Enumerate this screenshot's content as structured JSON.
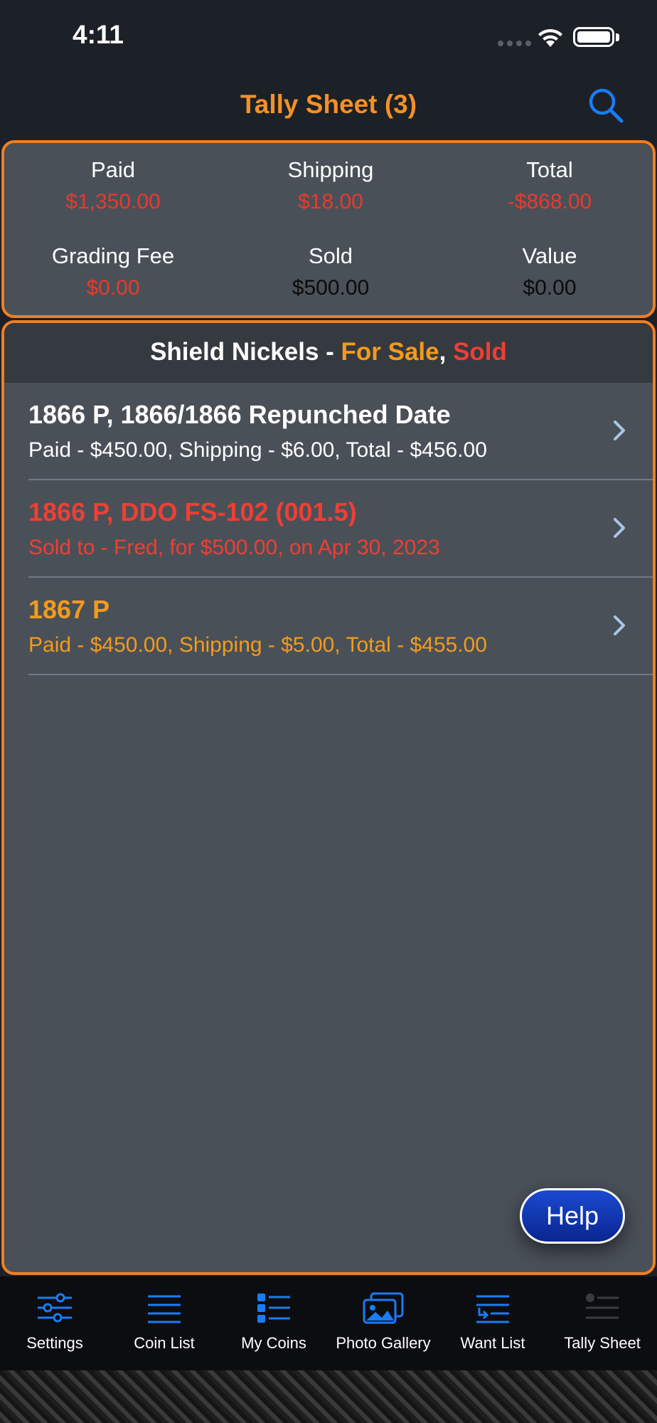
{
  "status_bar": {
    "time": "4:11"
  },
  "nav": {
    "title": "Tally Sheet (3)"
  },
  "summary": {
    "paid_label": "Paid",
    "paid_value": "$1,350.00",
    "shipping_label": "Shipping",
    "shipping_value": "$18.00",
    "total_label": "Total",
    "total_value": "-$868.00",
    "grading_label": "Grading Fee",
    "grading_value": "$0.00",
    "sold_label": "Sold",
    "sold_value": "$500.00",
    "value_label": "Value",
    "value_value": "$0.00"
  },
  "section": {
    "title": "Shield Nickels - ",
    "for_sale": "For Sale",
    "comma": ", ",
    "sold": "Sold"
  },
  "items": [
    {
      "title": "1866 P, 1866/1866 Repunched Date",
      "subtitle": "Paid - $450.00, Shipping - $6.00, Total - $456.00",
      "color": "#ffffff"
    },
    {
      "title": "1866 P, DDO FS-102 (001.5)",
      "subtitle": "Sold to - Fred, for $500.00, on Apr 30, 2023",
      "color": "#ee3f34"
    },
    {
      "title": "1867 P",
      "subtitle": "Paid - $450.00, Shipping - $5.00, Total - $455.00",
      "color": "#f39b1c"
    }
  ],
  "help_label": "Help",
  "tabs": [
    {
      "label": "Settings",
      "icon": "sliders-icon"
    },
    {
      "label": "Coin List",
      "icon": "list-icon"
    },
    {
      "label": "My Coins",
      "icon": "bulleted-list-icon"
    },
    {
      "label": "Photo Gallery",
      "icon": "photos-icon"
    },
    {
      "label": "Want List",
      "icon": "want-list-icon"
    },
    {
      "label": "Tally Sheet",
      "icon": "tally-icon"
    }
  ],
  "colors": {
    "accent": "#f07f22",
    "blue": "#1a7cf5",
    "red": "#e83a2e",
    "orange": "#f39b1c"
  }
}
